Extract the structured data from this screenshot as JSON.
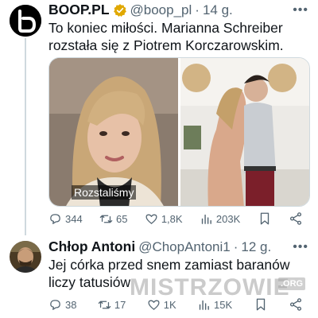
{
  "tweet1": {
    "display_name": "BOOP.PL",
    "handle": "@boop_pl",
    "separator": "·",
    "time": "14 g.",
    "text": "To koniec miłości. Marianna Schreiber rozstała się z Piotrem Korczarowskim.",
    "media_caption": "Rozstaliśmy",
    "stats": {
      "replies": "344",
      "retweets": "65",
      "likes": "1,8K",
      "views": "203K"
    }
  },
  "tweet2": {
    "display_name": "Chłop Antoni",
    "handle": "@ChopAntoni1",
    "separator": "·",
    "time": "12 g.",
    "text": "Jej córka przed snem zamiast baranów liczy tatusiów",
    "stats": {
      "replies": "38",
      "retweets": "17",
      "likes": "1K",
      "views": "15K"
    }
  },
  "watermark": {
    "text": "MISTRZOWIE",
    "suffix": ".ORG"
  },
  "colors": {
    "text": "#0f1419",
    "muted": "#536471",
    "verified": "#e0a800",
    "border": "#cfd9de"
  },
  "icons": [
    "reply-icon",
    "retweet-icon",
    "like-icon",
    "views-icon",
    "bookmark-icon",
    "share-icon",
    "more-icon",
    "verified-badge-icon"
  ]
}
